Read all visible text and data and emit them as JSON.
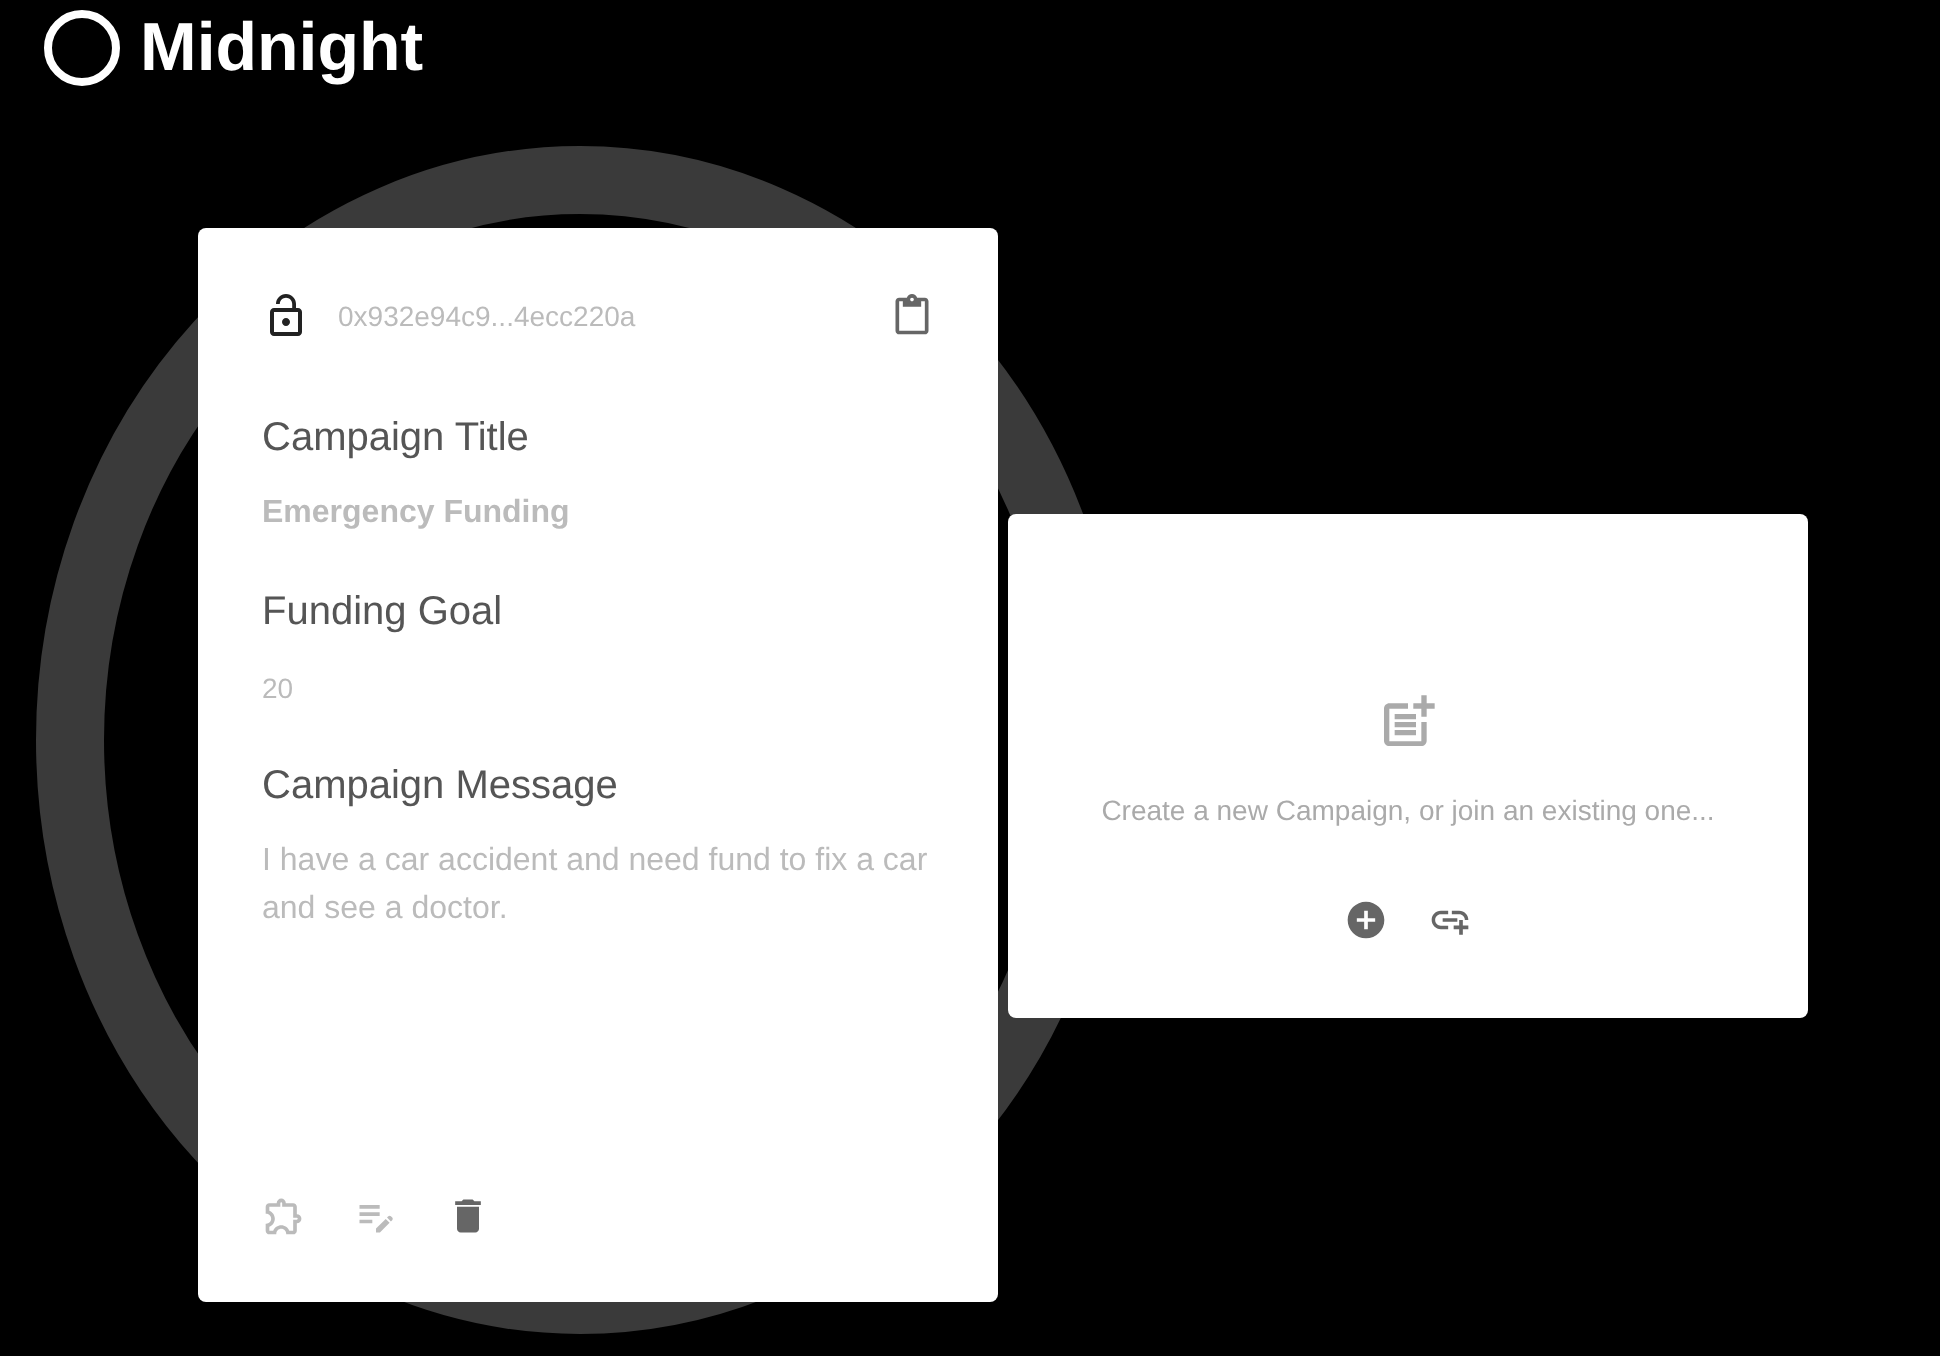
{
  "logo": {
    "name": "Midnight"
  },
  "campaign_card": {
    "address": "0x932e94c9...4ecc220a",
    "locked": false,
    "fields": [
      {
        "label": "Campaign Title",
        "value": "Emergency Funding",
        "kind": "title"
      },
      {
        "label": "Funding Goal",
        "value": "20",
        "kind": "small"
      },
      {
        "label": "Campaign Message",
        "value": "I have a car accident and need fund to fix a car and see a doctor.",
        "kind": "message"
      }
    ]
  },
  "new_card": {
    "message": "Create a new Campaign, or join an existing one..."
  }
}
